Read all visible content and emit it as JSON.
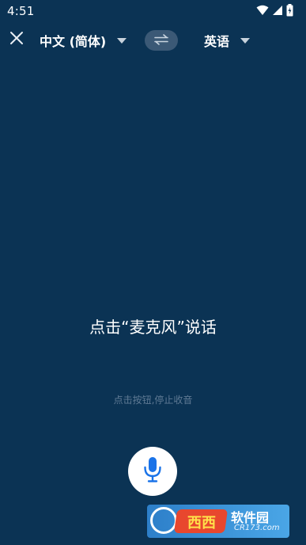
{
  "status_bar": {
    "time": "4:51",
    "icons": [
      "wifi-icon",
      "signal-icon",
      "battery-charging-icon"
    ]
  },
  "toolbar": {
    "close_icon": "close-icon",
    "source_language": "中文 (简体)",
    "swap_icon": "swap-arrows-icon",
    "target_language": "英语"
  },
  "main": {
    "prompt": "点击“麦克风”说话",
    "hint": "点击按钮,停止收音",
    "mic_icon": "microphone-icon"
  },
  "watermark": {
    "tag_text": "西西",
    "brand": "软件园",
    "domain": "CR173.com"
  },
  "colors": {
    "background": "#0b3354",
    "swap_pill": "#3b5976",
    "mic_accent": "#1a73e8",
    "hint_text": "#5f7a94"
  }
}
